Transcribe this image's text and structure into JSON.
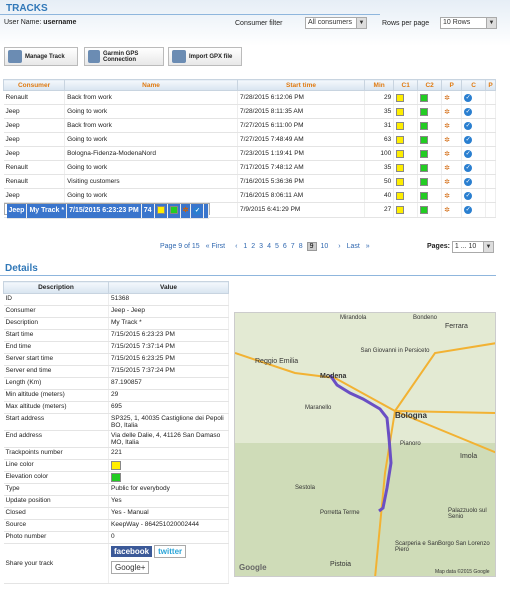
{
  "header": {
    "title": "TRACKS",
    "user_label": "User Name:",
    "user_name": "username",
    "consumer_filter_label": "Consumer filter",
    "consumer_filter_value": "All consumers",
    "rows_per_page_label": "Rows per page",
    "rows_per_page_value": "10 Rows"
  },
  "toolbar": {
    "manage": "Manage Track",
    "garmin": "Garmin GPS Connection",
    "import": "Import GPX file"
  },
  "tracks": {
    "columns": [
      "Consumer",
      "Name",
      "Start time",
      "Min",
      "C1",
      "C2",
      "P",
      "C",
      "P"
    ],
    "rows": [
      {
        "consumer": "Renault",
        "name": "Back from work",
        "start": "7/28/2015 6:12:06 PM",
        "min": "29",
        "c1": "#ffee00",
        "c2": "#22cc22"
      },
      {
        "consumer": "Jeep",
        "name": "Going to work",
        "start": "7/28/2015 8:11:35 AM",
        "min": "35",
        "c1": "#ffee00",
        "c2": "#22cc22"
      },
      {
        "consumer": "Jeep",
        "name": "Back from work",
        "start": "7/27/2015 6:11:00 PM",
        "min": "31",
        "c1": "#ffee00",
        "c2": "#22cc22"
      },
      {
        "consumer": "Jeep",
        "name": "Going to work",
        "start": "7/27/2015 7:48:49 AM",
        "min": "63",
        "c1": "#ffee00",
        "c2": "#22cc22"
      },
      {
        "consumer": "Jeep",
        "name": "Bologna-Fidenza-ModenaNord",
        "start": "7/23/2015 1:19:41 PM",
        "min": "100",
        "c1": "#ffee00",
        "c2": "#22cc22"
      },
      {
        "consumer": "Renault",
        "name": "Going to work",
        "start": "7/17/2015 7:48:12 AM",
        "min": "35",
        "c1": "#ffee00",
        "c2": "#22cc22"
      },
      {
        "consumer": "Renault",
        "name": "Visiting customers",
        "start": "7/16/2015 5:36:36 PM",
        "min": "50",
        "c1": "#ffee00",
        "c2": "#22cc22"
      },
      {
        "consumer": "Jeep",
        "name": "Going to work",
        "start": "7/16/2015 8:06:11 AM",
        "min": "40",
        "c1": "#ffee00",
        "c2": "#22cc22"
      },
      {
        "consumer": "Jeep",
        "name": "My Track *",
        "start": "7/15/2015 6:23:23 PM",
        "min": "74",
        "c1": "#ffee00",
        "c2": "#22cc22",
        "selected": true
      },
      {
        "consumer": "Jeep",
        "name": "My Track",
        "start": "7/9/2015 6:41:29 PM",
        "min": "27",
        "c1": "#ffee00",
        "c2": "#22cc22"
      }
    ]
  },
  "pager": {
    "info": "Page 9 of 15",
    "first": "First",
    "pages": [
      "1",
      "2",
      "3",
      "4",
      "5",
      "6",
      "7",
      "8",
      "9",
      "10"
    ],
    "current": "9",
    "last": "Last",
    "pages_label": "Pages:",
    "pages_value": "1 ... 10"
  },
  "details": {
    "title": "Details",
    "col_desc": "Description",
    "col_value": "Value",
    "rows": [
      [
        "ID",
        "51368"
      ],
      [
        "Consumer",
        "Jeep - Jeep"
      ],
      [
        "Description",
        "My Track *"
      ],
      [
        "Start time",
        "7/15/2015 6:23:23 PM"
      ],
      [
        "End time",
        "7/15/2015 7:37:14 PM"
      ],
      [
        "Server start time",
        "7/15/2015 6:23:25 PM"
      ],
      [
        "Server end time",
        "7/15/2015 7:37:24 PM"
      ],
      [
        "Length (Km)",
        "87.190857"
      ],
      [
        "Min altitude (meters)",
        "29"
      ],
      [
        "Max altitude (meters)",
        "695"
      ],
      [
        "Start address",
        "SP325, 1, 40035 Castiglione dei Pepoli BO, Italia"
      ],
      [
        "End address",
        "Via delle Dalie, 4, 41126 San Damaso MO, Italia"
      ],
      [
        "Trackpoints number",
        "221"
      ],
      [
        "Line color",
        ""
      ],
      [
        "Elevation color",
        ""
      ],
      [
        "Type",
        "Public for everybody"
      ],
      [
        "Update position",
        "Yes"
      ],
      [
        "Closed",
        "Yes - Manual"
      ],
      [
        "Source",
        "KeepWay - 864251020002444"
      ],
      [
        "Photo number",
        "0"
      ]
    ],
    "line_color": "#ffee00",
    "elevation_color": "#22cc22",
    "share_label": "Share your track",
    "facebook": "facebook",
    "twitter": "twitter",
    "google": "Google+"
  },
  "map": {
    "labels": [
      "Mirandola",
      "Bondeno",
      "Ferrara",
      "Reggio Emilia",
      "Modena",
      "San Giovanni in Persiceto",
      "Bologna",
      "Maranello",
      "Pianoro",
      "Imola",
      "Sestola",
      "Porretta Terme",
      "Palazzuolo sul Senio",
      "Scarperia e San Piero",
      "Borgo San Lorenzo",
      "Pistoia",
      "Google",
      "Map data ©2015 Google"
    ]
  }
}
